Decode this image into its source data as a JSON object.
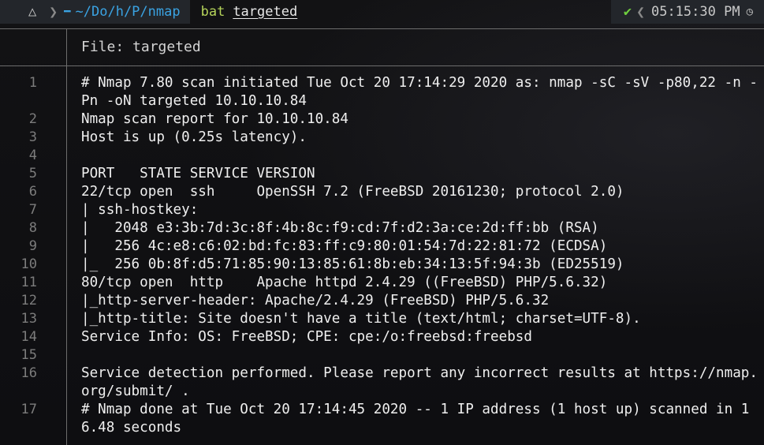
{
  "prompt": {
    "os_icon": "linux-penguin-icon",
    "os_glyph": "△",
    "folder_icon": "folder-icon",
    "folder_glyph": "━",
    "path": "~/Do/h/P/nmap",
    "command": "bat",
    "argument": "targeted",
    "status_glyph": "✔",
    "time": "05:15:30 PM",
    "clock_glyph": "◷"
  },
  "bat": {
    "header": "File: targeted",
    "lines": [
      {
        "no": "1",
        "text": "# Nmap 7.80 scan initiated Tue Oct 20 17:14:29 2020 as: nmap -sC -sV -p80,22 -n -Pn -oN targeted 10.10.10.84"
      },
      {
        "no": "2",
        "text": "Nmap scan report for 10.10.10.84"
      },
      {
        "no": "3",
        "text": "Host is up (0.25s latency)."
      },
      {
        "no": "4",
        "text": ""
      },
      {
        "no": "5",
        "text": "PORT   STATE SERVICE VERSION"
      },
      {
        "no": "6",
        "text": "22/tcp open  ssh     OpenSSH 7.2 (FreeBSD 20161230; protocol 2.0)"
      },
      {
        "no": "7",
        "text": "| ssh-hostkey: "
      },
      {
        "no": "8",
        "text": "|   2048 e3:3b:7d:3c:8f:4b:8c:f9:cd:7f:d2:3a:ce:2d:ff:bb (RSA)"
      },
      {
        "no": "9",
        "text": "|   256 4c:e8:c6:02:bd:fc:83:ff:c9:80:01:54:7d:22:81:72 (ECDSA)"
      },
      {
        "no": "10",
        "text": "|_  256 0b:8f:d5:71:85:90:13:85:61:8b:eb:34:13:5f:94:3b (ED25519)"
      },
      {
        "no": "11",
        "text": "80/tcp open  http    Apache httpd 2.4.29 ((FreeBSD) PHP/5.6.32)"
      },
      {
        "no": "12",
        "text": "|_http-server-header: Apache/2.4.29 (FreeBSD) PHP/5.6.32"
      },
      {
        "no": "13",
        "text": "|_http-title: Site doesn't have a title (text/html; charset=UTF-8)."
      },
      {
        "no": "14",
        "text": "Service Info: OS: FreeBSD; CPE: cpe:/o:freebsd:freebsd"
      },
      {
        "no": "15",
        "text": ""
      },
      {
        "no": "16",
        "text": "Service detection performed. Please report any incorrect results at https://nmap.org/submit/ ."
      },
      {
        "no": "17",
        "text": "# Nmap done at Tue Oct 20 17:14:45 2020 -- 1 IP address (1 host up) scanned in 16.48 seconds"
      }
    ]
  }
}
